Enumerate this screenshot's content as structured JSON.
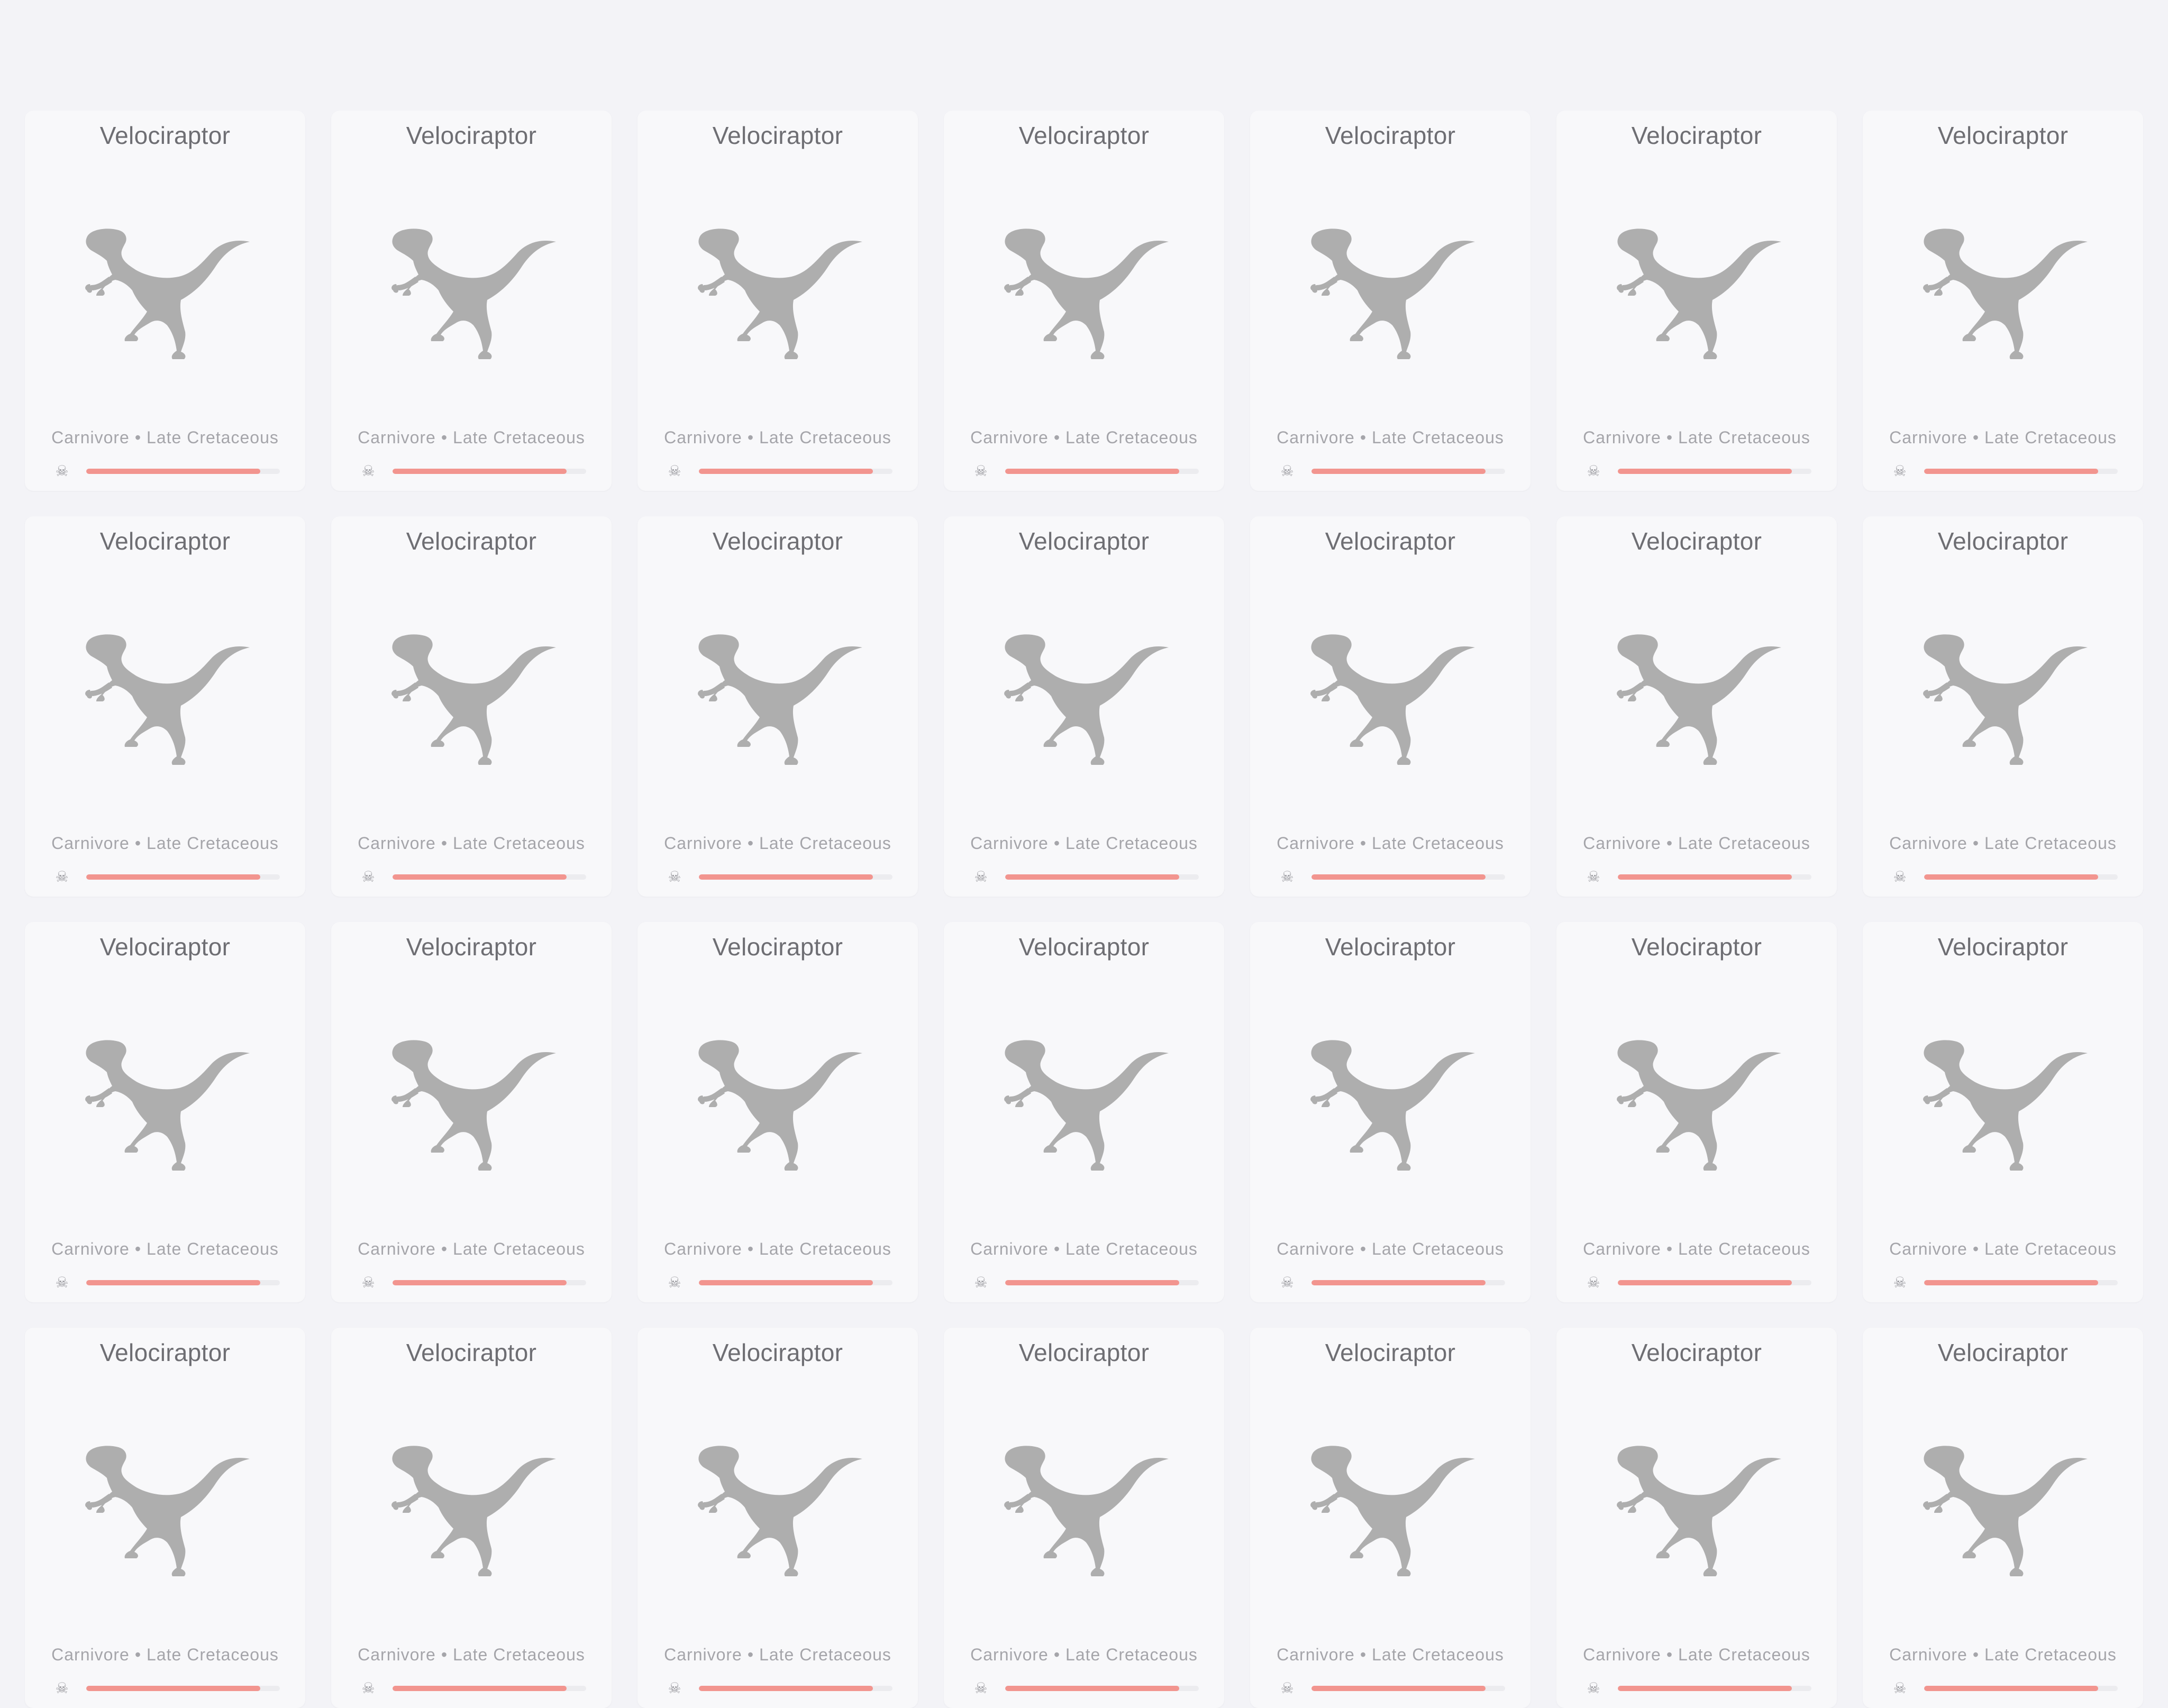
{
  "accent_color": "#f2958f",
  "silhouette_color": "#aeaeae",
  "danger_icon": "skull-icon",
  "dinosaur_image": "velociraptor-silhouette",
  "cards": [
    {
      "name": "Velociraptor",
      "diet": "Carnivore",
      "separator": "•",
      "period": "Late Cretaceous",
      "danger_level": 0.9
    },
    {
      "name": "Velociraptor",
      "diet": "Carnivore",
      "separator": "•",
      "period": "Late Cretaceous",
      "danger_level": 0.9
    },
    {
      "name": "Velociraptor",
      "diet": "Carnivore",
      "separator": "•",
      "period": "Late Cretaceous",
      "danger_level": 0.9
    },
    {
      "name": "Velociraptor",
      "diet": "Carnivore",
      "separator": "•",
      "period": "Late Cretaceous",
      "danger_level": 0.9
    },
    {
      "name": "Velociraptor",
      "diet": "Carnivore",
      "separator": "•",
      "period": "Late Cretaceous",
      "danger_level": 0.9
    },
    {
      "name": "Velociraptor",
      "diet": "Carnivore",
      "separator": "•",
      "period": "Late Cretaceous",
      "danger_level": 0.9
    },
    {
      "name": "Velociraptor",
      "diet": "Carnivore",
      "separator": "•",
      "period": "Late Cretaceous",
      "danger_level": 0.9
    },
    {
      "name": "Velociraptor",
      "diet": "Carnivore",
      "separator": "•",
      "period": "Late Cretaceous",
      "danger_level": 0.9
    },
    {
      "name": "Velociraptor",
      "diet": "Carnivore",
      "separator": "•",
      "period": "Late Cretaceous",
      "danger_level": 0.9
    },
    {
      "name": "Velociraptor",
      "diet": "Carnivore",
      "separator": "•",
      "period": "Late Cretaceous",
      "danger_level": 0.9
    },
    {
      "name": "Velociraptor",
      "diet": "Carnivore",
      "separator": "•",
      "period": "Late Cretaceous",
      "danger_level": 0.9
    },
    {
      "name": "Velociraptor",
      "diet": "Carnivore",
      "separator": "•",
      "period": "Late Cretaceous",
      "danger_level": 0.9
    },
    {
      "name": "Velociraptor",
      "diet": "Carnivore",
      "separator": "•",
      "period": "Late Cretaceous",
      "danger_level": 0.9
    },
    {
      "name": "Velociraptor",
      "diet": "Carnivore",
      "separator": "•",
      "period": "Late Cretaceous",
      "danger_level": 0.9
    },
    {
      "name": "Velociraptor",
      "diet": "Carnivore",
      "separator": "•",
      "period": "Late Cretaceous",
      "danger_level": 0.9
    },
    {
      "name": "Velociraptor",
      "diet": "Carnivore",
      "separator": "•",
      "period": "Late Cretaceous",
      "danger_level": 0.9
    },
    {
      "name": "Velociraptor",
      "diet": "Carnivore",
      "separator": "•",
      "period": "Late Cretaceous",
      "danger_level": 0.9
    },
    {
      "name": "Velociraptor",
      "diet": "Carnivore",
      "separator": "•",
      "period": "Late Cretaceous",
      "danger_level": 0.9
    },
    {
      "name": "Velociraptor",
      "diet": "Carnivore",
      "separator": "•",
      "period": "Late Cretaceous",
      "danger_level": 0.9
    },
    {
      "name": "Velociraptor",
      "diet": "Carnivore",
      "separator": "•",
      "period": "Late Cretaceous",
      "danger_level": 0.9
    },
    {
      "name": "Velociraptor",
      "diet": "Carnivore",
      "separator": "•",
      "period": "Late Cretaceous",
      "danger_level": 0.9
    },
    {
      "name": "Velociraptor",
      "diet": "Carnivore",
      "separator": "•",
      "period": "Late Cretaceous",
      "danger_level": 0.9
    },
    {
      "name": "Velociraptor",
      "diet": "Carnivore",
      "separator": "•",
      "period": "Late Cretaceous",
      "danger_level": 0.9
    },
    {
      "name": "Velociraptor",
      "diet": "Carnivore",
      "separator": "•",
      "period": "Late Cretaceous",
      "danger_level": 0.9
    },
    {
      "name": "Velociraptor",
      "diet": "Carnivore",
      "separator": "•",
      "period": "Late Cretaceous",
      "danger_level": 0.9
    },
    {
      "name": "Velociraptor",
      "diet": "Carnivore",
      "separator": "•",
      "period": "Late Cretaceous",
      "danger_level": 0.9
    },
    {
      "name": "Velociraptor",
      "diet": "Carnivore",
      "separator": "•",
      "period": "Late Cretaceous",
      "danger_level": 0.9
    },
    {
      "name": "Velociraptor",
      "diet": "Carnivore",
      "separator": "•",
      "period": "Late Cretaceous",
      "danger_level": 0.9
    }
  ]
}
